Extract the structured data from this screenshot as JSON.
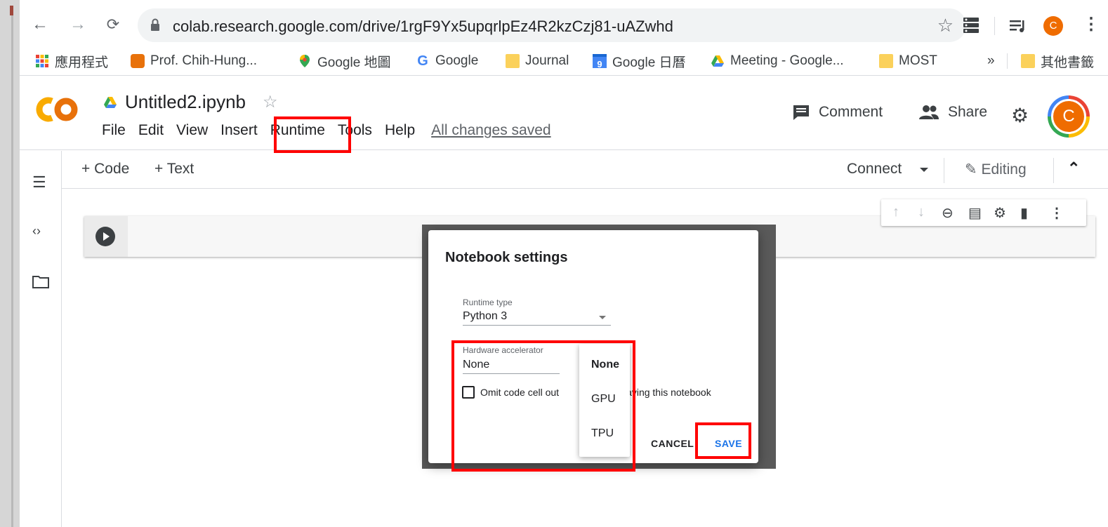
{
  "browser": {
    "url": "colab.research.google.com/drive/1rgF9Yx5upqrlpEz4R2kzCzj81-uAZwhd",
    "profile_initial": "C",
    "bookmarks": [
      {
        "label": "應用程式",
        "icon": "apps-grid-icon"
      },
      {
        "label": "Prof. Chih-Hung...",
        "icon": "page-favicon-icon"
      },
      {
        "label": "Google 地圖",
        "icon": "maps-pin-icon"
      },
      {
        "label": "Google",
        "icon": "google-g-icon"
      },
      {
        "label": "Journal",
        "icon": "folder-icon"
      },
      {
        "label": "Google 日曆",
        "icon": "calendar-icon"
      },
      {
        "label": "Meeting - Google...",
        "icon": "drive-icon"
      },
      {
        "label": "MOST",
        "icon": "folder-icon"
      },
      {
        "label": "»",
        "icon": ""
      },
      {
        "label": "其他書籤",
        "icon": "folder-icon"
      }
    ],
    "calendar_day": "9"
  },
  "colab": {
    "logo_text": "CO",
    "notebook_name": "Untitled2.ipynb",
    "menu": [
      "File",
      "Edit",
      "View",
      "Insert",
      "Runtime",
      "Tools",
      "Help"
    ],
    "save_status": "All changes saved",
    "comment_label": "Comment",
    "share_label": "Share",
    "avatar_initial": "C",
    "add_code": "+ Code",
    "add_text": "+ Text",
    "connect_label": "Connect",
    "editing_label": "Editing"
  },
  "dialog": {
    "title": "Notebook settings",
    "runtime_label": "Runtime type",
    "runtime_value": "Python 3",
    "accel_label": "Hardware accelerator",
    "accel_value": "None",
    "omit_text_left": "Omit code cell out",
    "omit_text_right": "aving this notebook",
    "cancel_label": "CANCEL",
    "save_label": "SAVE",
    "help_glyph": "?",
    "options": [
      "None",
      "GPU",
      "TPU"
    ],
    "selected_option": "None"
  },
  "colors": {
    "highlight": "#ff0000",
    "save_blue": "#1a73e8",
    "avatar_orange": "#ef6c00"
  }
}
